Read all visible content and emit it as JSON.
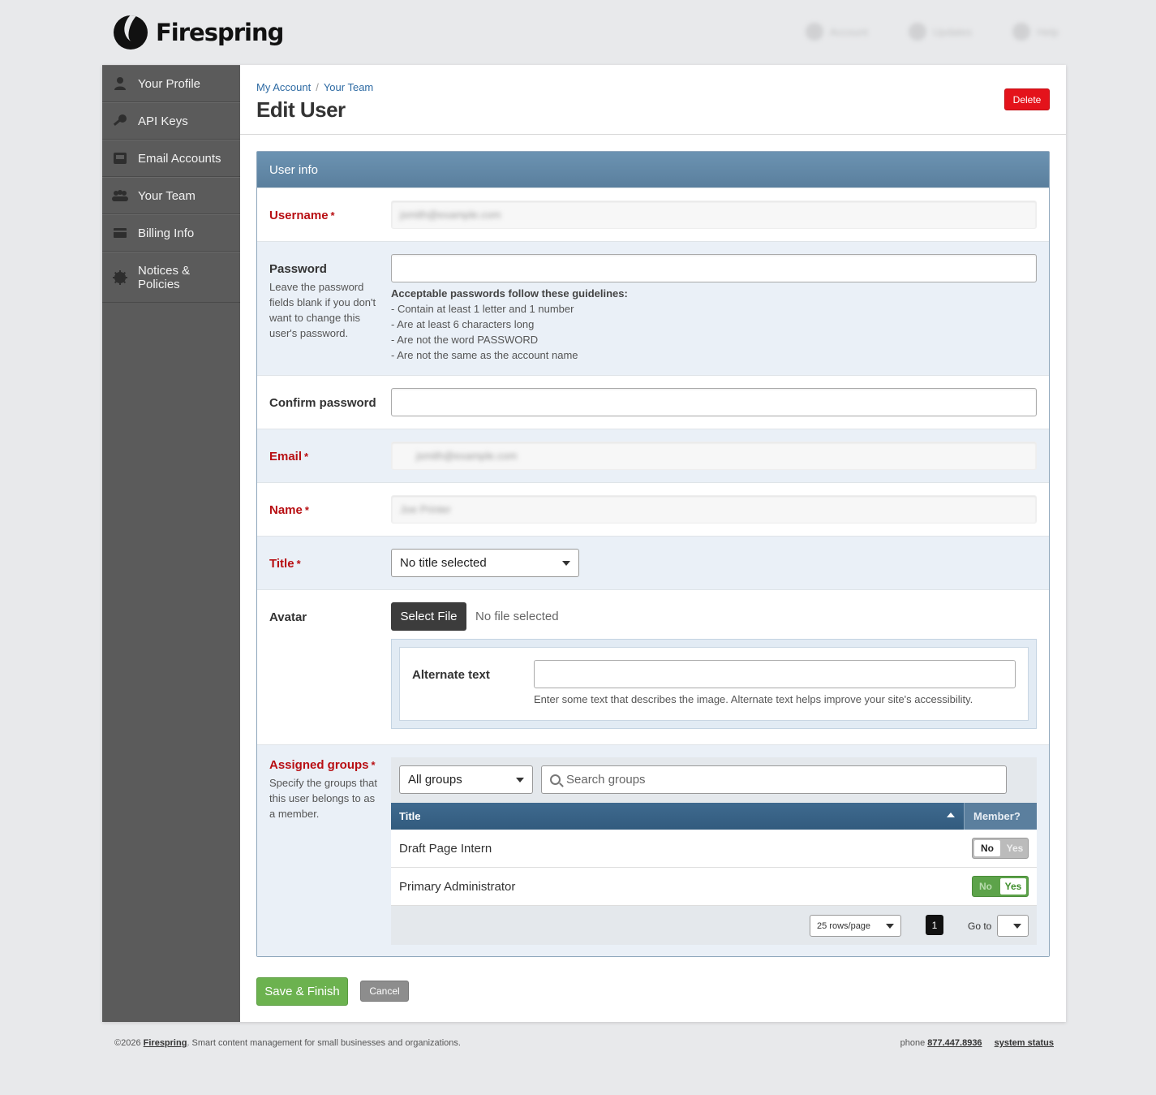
{
  "brand": {
    "name": "Firespring",
    "trademark": "®"
  },
  "top_links": [
    "Account",
    "Updates",
    "Help"
  ],
  "sidebar": {
    "items": [
      {
        "label": "Your Profile",
        "icon": "person-icon"
      },
      {
        "label": "API Keys",
        "icon": "key-icon"
      },
      {
        "label": "Email Accounts",
        "icon": "inbox-icon"
      },
      {
        "label": "Your Team",
        "icon": "team-icon"
      },
      {
        "label": "Billing Info",
        "icon": "card-icon"
      },
      {
        "label": "Notices & Policies",
        "icon": "gear-icon"
      }
    ]
  },
  "breadcrumb": {
    "items": [
      "My Account",
      "Your Team"
    ],
    "separator": "/"
  },
  "page": {
    "title": "Edit User",
    "delete_label": "Delete"
  },
  "panel": {
    "title": "User info"
  },
  "form": {
    "required_mark": "*",
    "username": {
      "label": "Username",
      "value": "jsmith@example.com"
    },
    "password": {
      "label": "Password",
      "help": "Leave the password fields blank if you don't want to change this user's password.",
      "guidelines_title": "Acceptable passwords follow these guidelines:",
      "guidelines": [
        "- Contain at least 1 letter and 1 number",
        "- Are at least 6 characters long",
        "- Are not the word PASSWORD",
        "- Are not the same as the account name"
      ]
    },
    "confirm_password": {
      "label": "Confirm password"
    },
    "email": {
      "label": "Email",
      "value": "jsmith@example.com"
    },
    "name": {
      "label": "Name",
      "value": "Joe Printer"
    },
    "title": {
      "label": "Title",
      "selected": "No title selected"
    },
    "avatar": {
      "label": "Avatar",
      "button": "Select File",
      "status": "No file selected",
      "alt_label": "Alternate text",
      "alt_help": "Enter some text that describes the image. Alternate text helps improve your site's accessibility."
    },
    "groups": {
      "label": "Assigned groups",
      "help": "Specify the groups that this user belongs to as a member.",
      "filter_selected": "All groups",
      "search_placeholder": "Search groups",
      "columns": [
        "Title",
        "Member?"
      ],
      "rows": [
        {
          "title": "Draft Page Intern",
          "member": false
        },
        {
          "title": "Primary Administrator",
          "member": true
        }
      ],
      "toggle_no": "No",
      "toggle_yes": "Yes",
      "rows_per_page": "25 rows/page",
      "current_page": "1",
      "goto_label": "Go to"
    }
  },
  "actions": {
    "save": "Save & Finish",
    "cancel": "Cancel"
  },
  "footer": {
    "copyright": "©2026",
    "brand": "Firespring",
    "tagline": ". Smart content management for small businesses and organizations.",
    "phone_label": "phone",
    "phone": "877.447.8936",
    "status_link": "system status"
  },
  "colors": {
    "accent": "#6cb24f",
    "danger": "#e4131b",
    "panel_header": "#5a7f9d",
    "required": "#b80f13"
  }
}
